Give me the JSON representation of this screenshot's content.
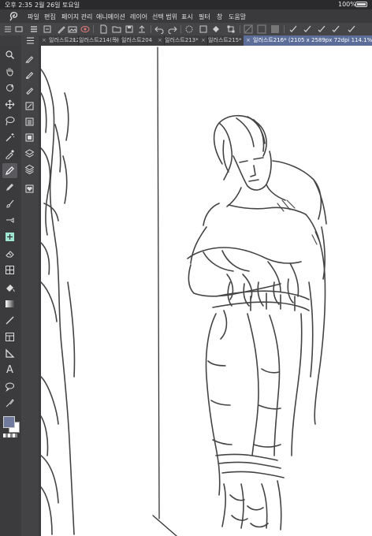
{
  "status": {
    "time": "오후 2:35",
    "date": "2월 26일 토요일",
    "battery": "100%"
  },
  "menu": [
    "파일",
    "편집",
    "페이지 관리",
    "애니메이션",
    "레이어",
    "선택 범위",
    "표시",
    "필터",
    "창",
    "도움말"
  ],
  "tabs": [
    {
      "label": "일러스트212(목)",
      "active": false
    },
    {
      "label": "일러스트214(목)",
      "active": false
    },
    {
      "label": "일러스트204",
      "active": false
    },
    {
      "label": "일러스트213*",
      "active": false
    },
    {
      "label": "일러스트215*",
      "active": false
    },
    {
      "label": "일러스트216* (2105 x 2589px 72dpi 114.1%)",
      "active": true
    }
  ],
  "colors": {
    "accent": "#5d6d9a",
    "panel": "#3b3b3d",
    "canvas": "#ffffff",
    "main_color": "#6f7a9c"
  },
  "tools": [
    "menu-icon",
    "zoom-icon",
    "hand-icon",
    "rotate-icon",
    "move-icon",
    "lasso-icon",
    "magic-wand-icon",
    "eyedropper-icon",
    "pen-icon",
    "pencil-icon",
    "brush-icon",
    "airbrush-icon",
    "blend-icon",
    "eraser-icon",
    "layer-move-icon",
    "fill-icon",
    "gradient-icon",
    "line-icon",
    "frame-icon",
    "ruler-icon",
    "text-icon",
    "balloon-icon",
    "correction-icon"
  ],
  "text_tool_glyph": "A"
}
